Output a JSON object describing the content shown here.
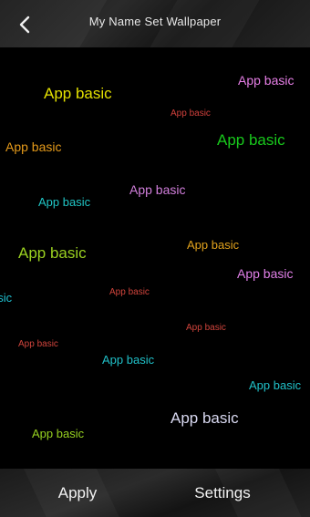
{
  "header": {
    "title": "My Name Set Wallpaper",
    "back_icon": "chevron-left-icon"
  },
  "preview": {
    "words": [
      {
        "text": "App basic",
        "color": "#e3e000"
      },
      {
        "text": "App basic",
        "color": "#e77fe7"
      },
      {
        "text": "App basic",
        "color": "#d0403c"
      },
      {
        "text": "App basic",
        "color": "#e59a1a"
      },
      {
        "text": "App basic",
        "color": "#18c81c"
      },
      {
        "text": "App basic",
        "color": "#d27fdc"
      },
      {
        "text": "App basic",
        "color": "#20c6c6"
      },
      {
        "text": "App basic",
        "color": "#9ad020"
      },
      {
        "text": "App basic",
        "color": "#e0a11c"
      },
      {
        "text": "App basic",
        "color": "#e07fe7"
      },
      {
        "text": "App basic",
        "color": "#1ec0d0"
      },
      {
        "text": "App basic",
        "color": "#d0443c"
      },
      {
        "text": "App basic",
        "color": "#d0443c"
      },
      {
        "text": "App basic",
        "color": "#d0443c"
      },
      {
        "text": "App basic",
        "color": "#20c0c8"
      },
      {
        "text": "App basic",
        "color": "#20c0c8"
      },
      {
        "text": "App basic",
        "color": "#d8d8f0"
      },
      {
        "text": "App basic",
        "color": "#96d020"
      }
    ]
  },
  "footer": {
    "apply_label": "Apply",
    "settings_label": "Settings"
  }
}
